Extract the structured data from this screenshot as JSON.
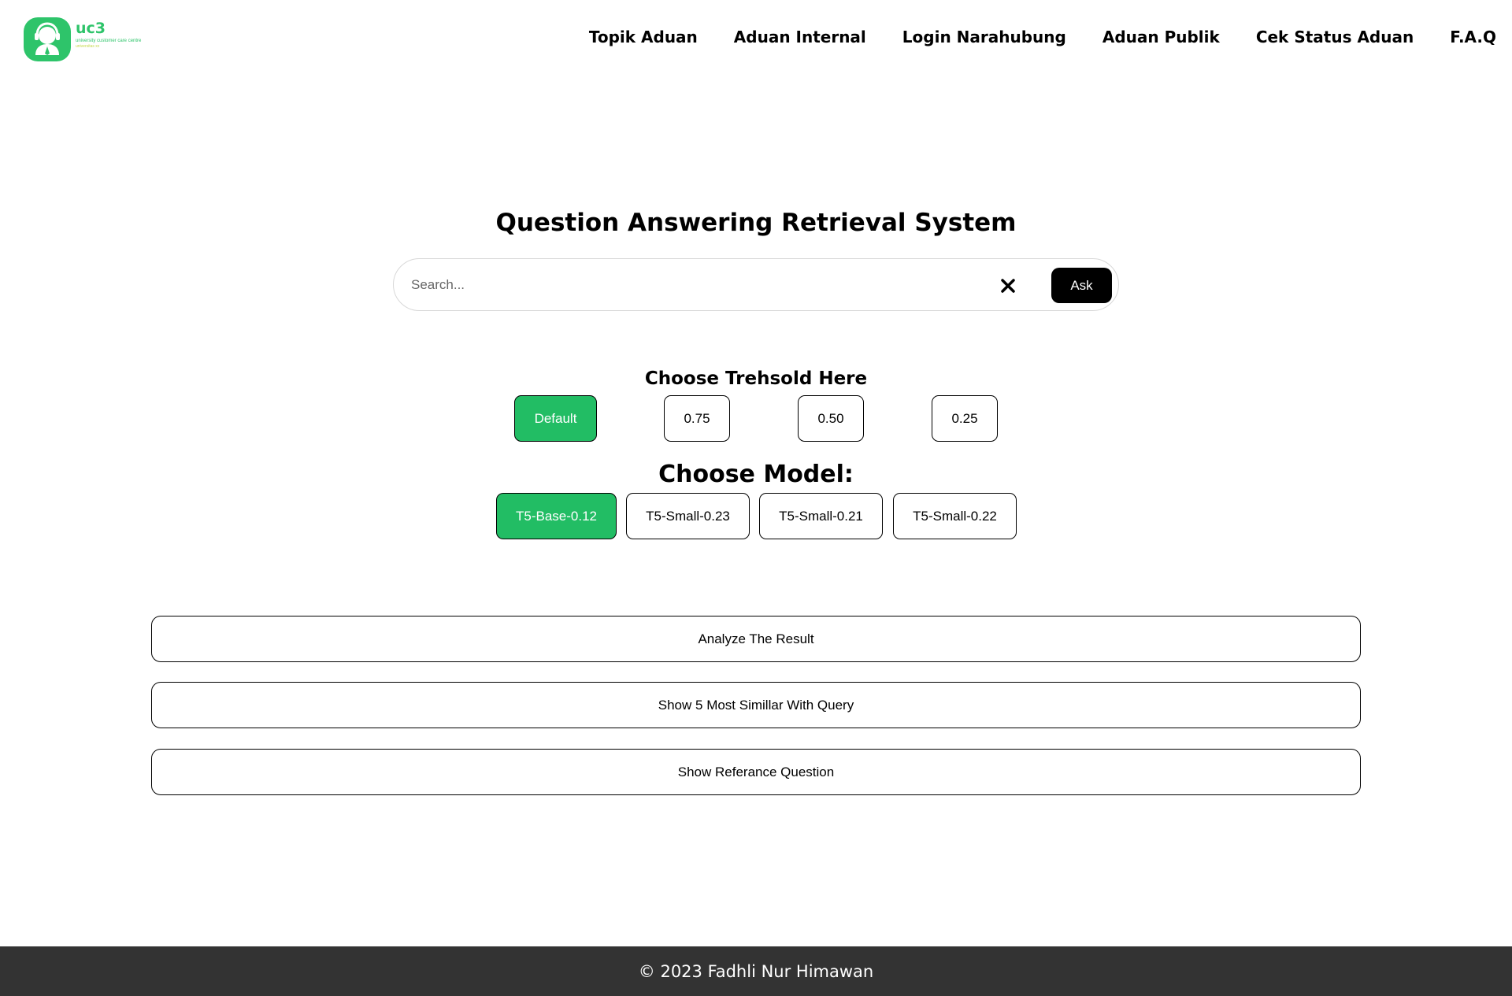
{
  "brand": {
    "name": "uc3",
    "tagline": "university customer care centre",
    "subtag": "universitas xx",
    "color": "#2ec46a"
  },
  "nav": {
    "items": [
      "Topik Aduan",
      "Aduan Internal",
      "Login Narahubung",
      "Aduan Publik",
      "Cek Status Aduan",
      "F.A.Q"
    ]
  },
  "main": {
    "title": "Question Answering Retrieval System",
    "search": {
      "placeholder": "Search...",
      "value": "",
      "clear_icon": "close-icon",
      "ask_label": "Ask"
    },
    "threshold": {
      "heading": "Choose Trehsold Here",
      "options": [
        "Default",
        "0.75",
        "0.50",
        "0.25"
      ],
      "selected": "Default"
    },
    "model": {
      "heading": "Choose Model:",
      "options": [
        "T5-Base-0.12",
        "T5-Small-0.23",
        "T5-Small-0.21",
        "T5-Small-0.22"
      ],
      "selected": "T5-Base-0.12"
    },
    "actions": [
      "Analyze The Result",
      "Show 5 Most Simillar With Query",
      "Show Referance Question"
    ]
  },
  "footer": {
    "text": "© 2023 Fadhli Nur Himawan"
  },
  "colors": {
    "accent": "#22bd64",
    "footer_bg": "#333333"
  }
}
